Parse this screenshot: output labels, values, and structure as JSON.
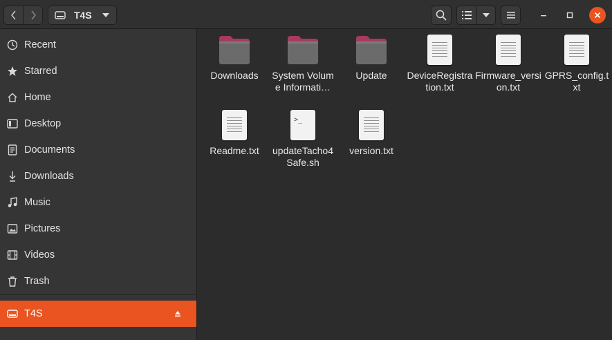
{
  "header": {
    "location": "T4S",
    "colors": {
      "close": "#e95420"
    },
    "icons": {
      "back": "chevron-left-icon",
      "forward": "chevron-right-icon",
      "drive": "drive-icon",
      "search": "search-icon",
      "list_view": "list-view-icon",
      "menu": "hamburger-menu-icon"
    }
  },
  "sidebar": {
    "items": [
      {
        "label": "Recent",
        "icon": "clock-icon"
      },
      {
        "label": "Starred",
        "icon": "star-icon"
      },
      {
        "label": "Home",
        "icon": "home-icon"
      },
      {
        "label": "Desktop",
        "icon": "desktop-icon"
      },
      {
        "label": "Documents",
        "icon": "document-icon"
      },
      {
        "label": "Downloads",
        "icon": "download-icon"
      },
      {
        "label": "Music",
        "icon": "music-icon"
      },
      {
        "label": "Pictures",
        "icon": "picture-icon"
      },
      {
        "label": "Videos",
        "icon": "video-icon"
      },
      {
        "label": "Trash",
        "icon": "trash-icon"
      }
    ],
    "device": {
      "label": "T4S",
      "icon": "drive-icon",
      "selected": true,
      "accent": "#e95420"
    }
  },
  "files": [
    {
      "name": "Downloads",
      "type": "folder"
    },
    {
      "name": "System Volume Informati…",
      "type": "folder"
    },
    {
      "name": "Update",
      "type": "folder"
    },
    {
      "name": "DeviceRegistration.txt",
      "type": "text"
    },
    {
      "name": "Firmware_version.txt",
      "type": "text"
    },
    {
      "name": "GPRS_config.txt",
      "type": "text"
    },
    {
      "name": "Readme.txt",
      "type": "text"
    },
    {
      "name": "updateTacho4Safe.sh",
      "type": "script"
    },
    {
      "name": "version.txt",
      "type": "text"
    }
  ]
}
